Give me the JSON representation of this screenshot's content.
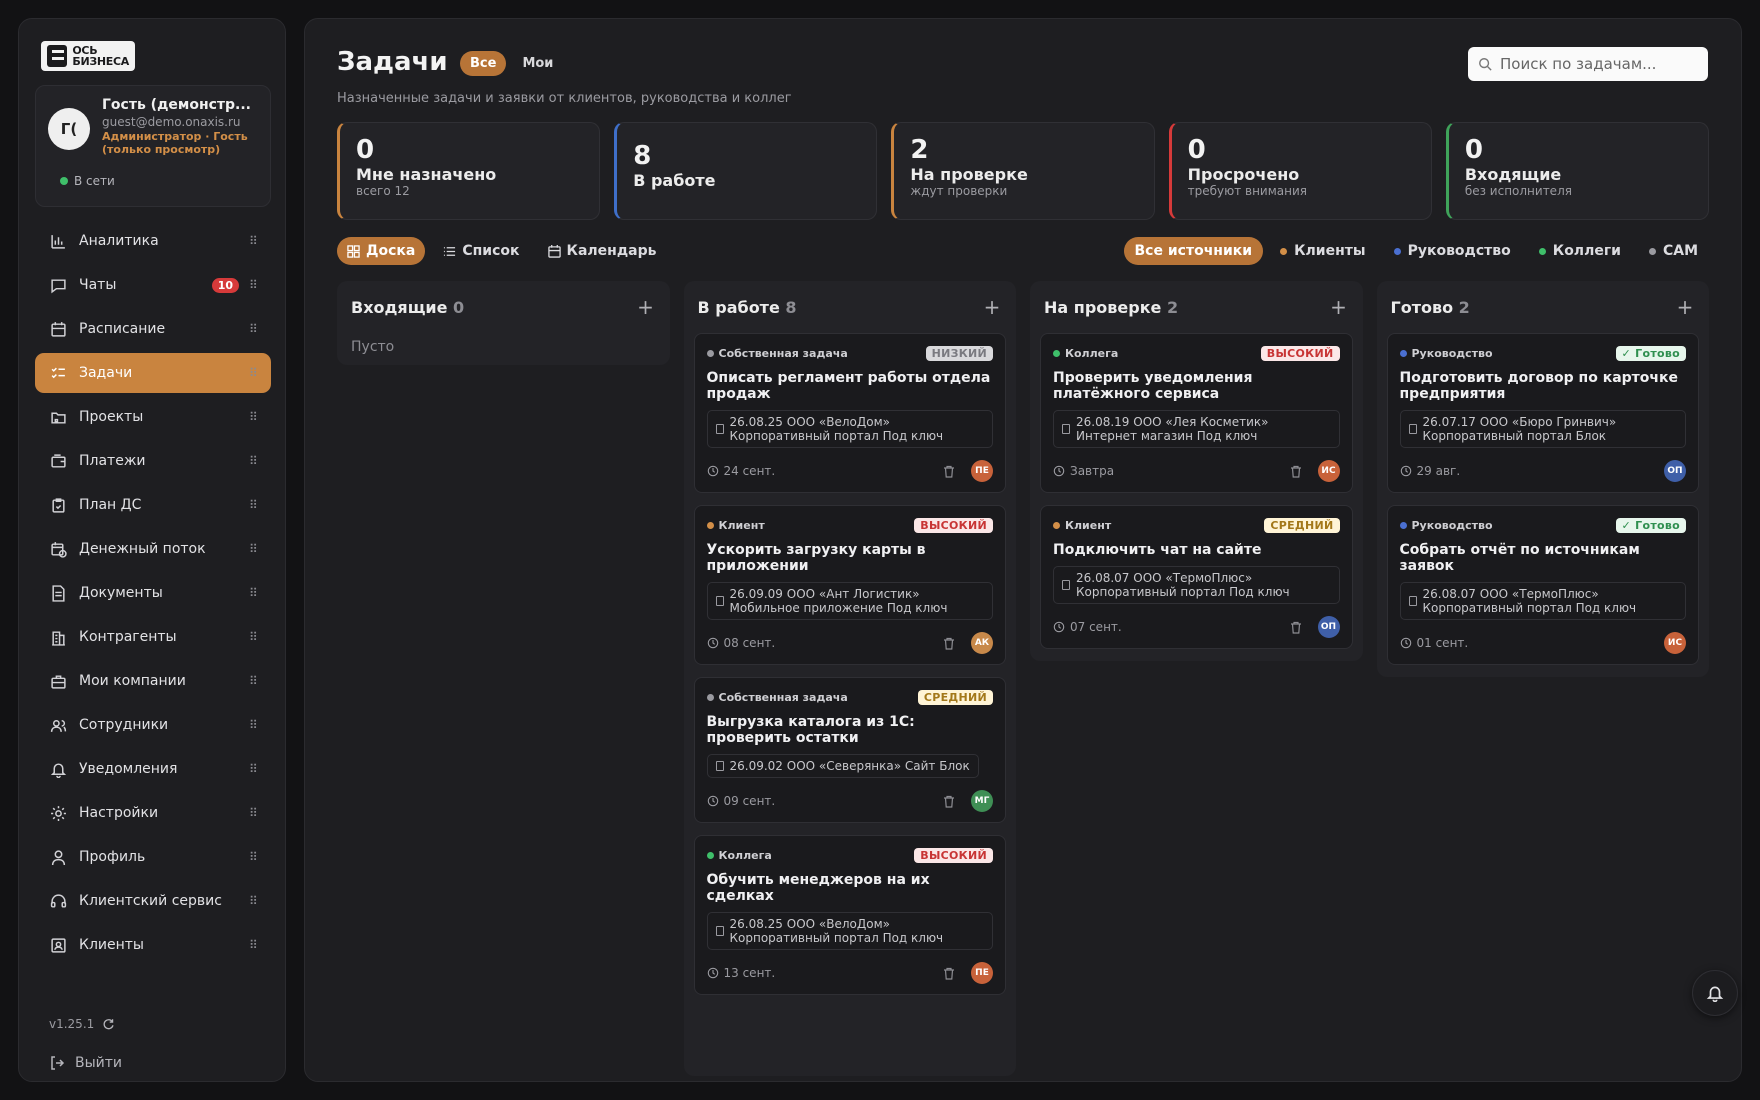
{
  "brand": {
    "logo_line1": "ОСЬ",
    "logo_line2": "БИЗНЕСА"
  },
  "user": {
    "initials": "Г(",
    "name": "Гость (демонстр...",
    "email": "guest@demo.onaxis.ru",
    "role": "Администратор · Гость (только просмотр)",
    "status": "В сети"
  },
  "sidebar": {
    "items": [
      {
        "label": "Аналитика",
        "icon": "chart-icon"
      },
      {
        "label": "Чаты",
        "icon": "chat-icon",
        "badge": "10"
      },
      {
        "label": "Расписание",
        "icon": "calendar-icon"
      },
      {
        "label": "Задачи",
        "icon": "tasks-icon",
        "active": true
      },
      {
        "label": "Проекты",
        "icon": "folder-icon"
      },
      {
        "label": "Платежи",
        "icon": "wallet-icon"
      },
      {
        "label": "План ДС",
        "icon": "clipboard-icon"
      },
      {
        "label": "Денежный поток",
        "icon": "calendar-flow-icon"
      },
      {
        "label": "Документы",
        "icon": "document-icon"
      },
      {
        "label": "Контрагенты",
        "icon": "building-icon"
      },
      {
        "label": "Мои компании",
        "icon": "briefcase-icon"
      },
      {
        "label": "Сотрудники",
        "icon": "users-icon"
      },
      {
        "label": "Уведомления",
        "icon": "bell-icon"
      },
      {
        "label": "Настройки",
        "icon": "gear-icon"
      },
      {
        "label": "Профиль",
        "icon": "user-icon"
      },
      {
        "label": "Клиентский сервис",
        "icon": "headset-icon"
      },
      {
        "label": "Клиенты",
        "icon": "contact-icon"
      }
    ],
    "version": "v1.25.1",
    "logout": "Выйти"
  },
  "header": {
    "title": "Задачи",
    "seg_all": "Все",
    "seg_mine": "Мои",
    "subtitle": "Назначенные задачи и заявки от клиентов, руководства и коллег",
    "search_placeholder": "Поиск по задачам..."
  },
  "stats": [
    {
      "value": "0",
      "label": "Мне назначено",
      "sub": "всего 12",
      "color": "#c9843f"
    },
    {
      "value": "8",
      "label": "В работе",
      "sub": "",
      "color": "#3f6fc9"
    },
    {
      "value": "2",
      "label": "На проверке",
      "sub": "ждут проверки",
      "color": "#c9843f"
    },
    {
      "value": "0",
      "label": "Просрочено",
      "sub": "требуют внимания",
      "color": "#d63a3a"
    },
    {
      "value": "0",
      "label": "Входящие",
      "sub": "без исполнителя",
      "color": "#3fa35a"
    }
  ],
  "views": {
    "board": "Доска",
    "list": "Список",
    "calendar": "Календарь"
  },
  "filters": [
    {
      "label": "Все источники",
      "active": true
    },
    {
      "label": "Клиенты",
      "color": "#d38f48"
    },
    {
      "label": "Руководство",
      "color": "#4a6fd1"
    },
    {
      "label": "Коллеги",
      "color": "#3fbf6a"
    },
    {
      "label": "САМ",
      "color": "#9a9aa0"
    }
  ],
  "columns": [
    {
      "title": "Входящие",
      "count": "0",
      "empty": "Пусто",
      "cards": []
    },
    {
      "title": "В работе",
      "count": "8",
      "cards": [
        {
          "source": "Собственная задача",
          "source_color": "#9a9aa0",
          "priority": "НИЗКИЙ",
          "prio_class": "low",
          "title": "Описать регламент работы отдела продаж",
          "project": "26.08.25 ООО «ВелоДом» Корпоративный портал Под ключ",
          "due": "24 сент.",
          "avatar": "ПЕ",
          "avatar_color": "#c8623a"
        },
        {
          "source": "Клиент",
          "source_color": "#d38f48",
          "priority": "ВЫСОКИЙ",
          "prio_class": "high",
          "title": "Ускорить загрузку карты в приложении",
          "project": "26.09.09 ООО «Ант Логистик» Мобильное приложение Под ключ",
          "due": "08 сент.",
          "avatar": "АК",
          "avatar_color": "#c8894a"
        },
        {
          "source": "Собственная задача",
          "source_color": "#9a9aa0",
          "priority": "СРЕДНИЙ",
          "prio_class": "mid",
          "title": "Выгрузка каталога из 1С: проверить остатки",
          "project": "26.09.02 ООО «Северянка» Сайт Блок",
          "project_inline": true,
          "due": "09 сент.",
          "avatar": "МГ",
          "avatar_color": "#3f8f55"
        },
        {
          "source": "Коллега",
          "source_color": "#3fbf6a",
          "priority": "ВЫСОКИЙ",
          "prio_class": "high",
          "title": "Обучить менеджеров на их сделках",
          "project": "26.08.25 ООО «ВелоДом» Корпоративный портал Под ключ",
          "due": "13 сент.",
          "avatar": "ПЕ",
          "avatar_color": "#c8623a"
        }
      ]
    },
    {
      "title": "На проверке",
      "count": "2",
      "cards": [
        {
          "source": "Коллега",
          "source_color": "#3fbf6a",
          "priority": "ВЫСОКИЙ",
          "prio_class": "high",
          "title": "Проверить уведомления платёжного сервиса",
          "project": "26.08.19 ООО «Лея Косметик» Интернет магазин Под ключ",
          "due": "Завтра",
          "avatar": "ИС",
          "avatar_color": "#c8623a"
        },
        {
          "source": "Клиент",
          "source_color": "#d38f48",
          "priority": "СРЕДНИЙ",
          "prio_class": "mid",
          "title": "Подключить чат на сайте",
          "project": "26.08.07 ООО «ТермоПлюс» Корпоративный портал Под ключ",
          "due": "07 сент.",
          "avatar": "ОП",
          "avatar_color": "#3f5fa8"
        }
      ]
    },
    {
      "title": "Готово",
      "count": "2",
      "cards": [
        {
          "source": "Руководство",
          "source_color": "#4a6fd1",
          "priority": "✓ Готово",
          "prio_class": "done",
          "title": "Подготовить договор по карточке предприятия",
          "project": "26.07.17 ООО «Бюро Гринвич» Корпоративный портал Блок",
          "due": "29 авг.",
          "avatar": "ОП",
          "avatar_color": "#3f5fa8",
          "no_trash": true
        },
        {
          "source": "Руководство",
          "source_color": "#4a6fd1",
          "priority": "✓ Готово",
          "prio_class": "done",
          "title": "Собрать отчёт по источникам заявок",
          "project": "26.08.07 ООО «ТермоПлюс» Корпоративный портал Под ключ",
          "due": "01 сент.",
          "avatar": "ИС",
          "avatar_color": "#c8623a",
          "no_trash": true
        }
      ]
    }
  ]
}
